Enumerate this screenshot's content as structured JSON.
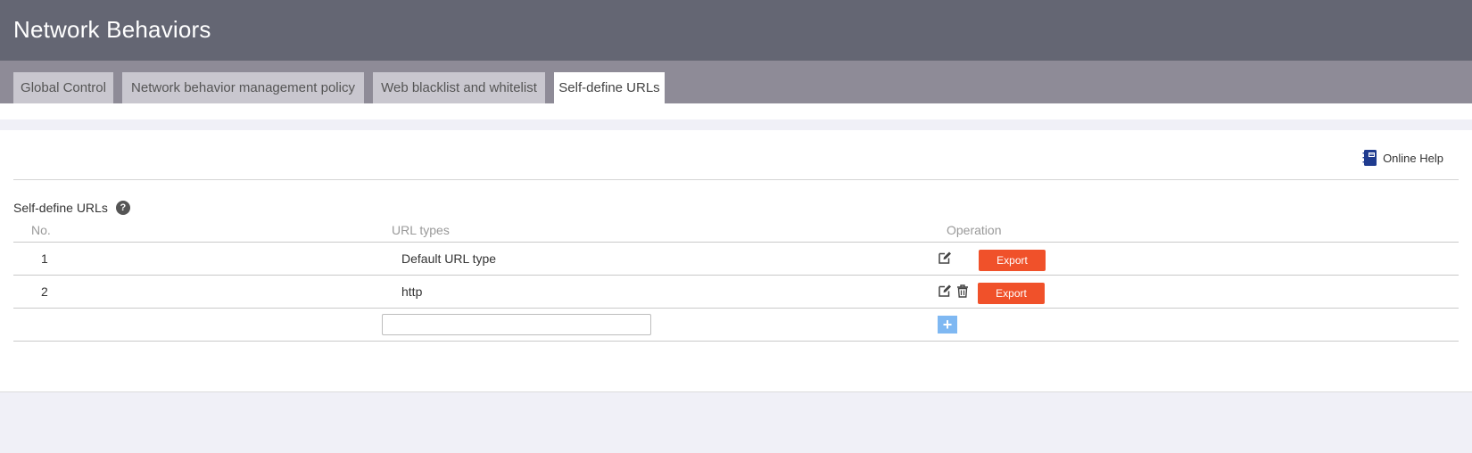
{
  "header": {
    "title": "Network Behaviors"
  },
  "tabs": [
    {
      "label": "Global Control"
    },
    {
      "label": "Network behavior management policy"
    },
    {
      "label": "Web blacklist and whitelist"
    },
    {
      "label": "Self-define URLs",
      "active": true
    }
  ],
  "help": {
    "label": "Online Help",
    "icon": "book-icon"
  },
  "section": {
    "title": "Self-define URLs",
    "help_icon": "?"
  },
  "table": {
    "columns": [
      "No.",
      "URL types",
      "Operation"
    ],
    "rows": [
      {
        "no": "1",
        "url_type": "Default URL type",
        "export_label": "Export",
        "deletable": false
      },
      {
        "no": "2",
        "url_type": "http",
        "export_label": "Export",
        "deletable": true
      }
    ],
    "new_row": {
      "input_value": "",
      "add_label": "+"
    }
  },
  "colors": {
    "header_bg": "#646673",
    "tabbar_bg": "#8e8b97",
    "export_bg": "#f0512a",
    "add_bg": "#7fb8f2"
  }
}
